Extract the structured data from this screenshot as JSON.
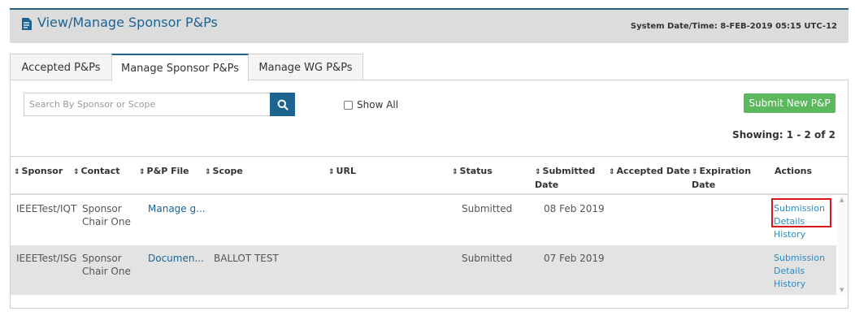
{
  "header": {
    "title": "View/Manage Sponsor P&Ps",
    "system_datetime": "System Date/Time: 8-FEB-2019  05:15 UTC-12",
    "icon": "document-edit-icon",
    "accent_color": "#1d6491"
  },
  "tabs": [
    {
      "label": "Accepted P&Ps",
      "active": false
    },
    {
      "label": "Manage Sponsor P&Ps",
      "active": true
    },
    {
      "label": "Manage WG P&Ps",
      "active": false
    }
  ],
  "toolbar": {
    "search_placeholder": "Search By Sponsor or Scope",
    "search_value": "",
    "search_icon": "search-icon",
    "show_all_label": "Show All",
    "show_all_checked": false,
    "submit_label": "Submit New P&P",
    "submit_color": "#5cb85c"
  },
  "showing": "Showing: 1 - 2 of 2",
  "table": {
    "columns": [
      {
        "label": "Sponsor",
        "sortable": true
      },
      {
        "label": "Contact",
        "sortable": true
      },
      {
        "label": "P&P File",
        "sortable": true
      },
      {
        "label": "Scope",
        "sortable": true
      },
      {
        "label": "URL",
        "sortable": true
      },
      {
        "label": "Status",
        "sortable": true
      },
      {
        "label": "Submitted Date",
        "sortable": true
      },
      {
        "label": "Accepted Date",
        "sortable": true
      },
      {
        "label": "Expiration Date",
        "sortable": true
      },
      {
        "label": "Actions",
        "sortable": false
      }
    ],
    "rows": [
      {
        "sponsor": "IEEETest/IQT",
        "contact": "Sponsor Chair One",
        "file": "Manage g...",
        "scope": "",
        "url": "",
        "status": "Submitted",
        "submitted": "08 Feb 2019",
        "accepted": "",
        "expiration": "",
        "actions": [
          "Submission Details",
          "History"
        ]
      },
      {
        "sponsor": "IEEETest/ISG",
        "contact": "Sponsor Chair One",
        "file": "Documen...",
        "scope": "BALLOT TEST",
        "url": "",
        "status": "Submitted",
        "submitted": "07 Feb 2019",
        "accepted": "",
        "expiration": "",
        "actions": [
          "Submission Details",
          "History"
        ]
      }
    ]
  }
}
